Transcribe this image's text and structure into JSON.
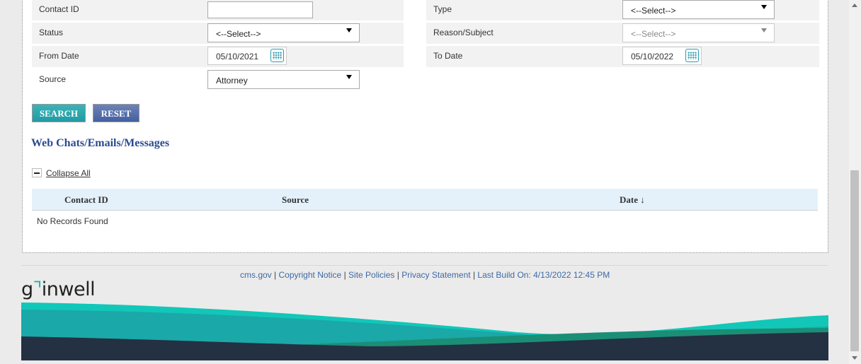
{
  "form": {
    "contact_id_label": "Contact ID",
    "contact_id_value": "",
    "type_label": "Type",
    "type_value": "<--Select-->",
    "status_label": "Status",
    "status_value": "<--Select-->",
    "reason_label": "Reason/Subject",
    "reason_value": "<--Select-->",
    "from_date_label": "From Date",
    "from_date_value": "05/10/2021",
    "to_date_label": "To Date",
    "to_date_value": "05/10/2022",
    "source_label": "Source",
    "source_value": "Attorney"
  },
  "buttons": {
    "search": "SEARCH",
    "reset": "RESET"
  },
  "section": {
    "title": "Web Chats/Emails/Messages",
    "collapse_all": "Collapse All"
  },
  "table": {
    "headers": {
      "contact_id": "Contact ID",
      "source": "Source",
      "date": "Date ↓"
    },
    "empty_message": "No Records Found"
  },
  "footer": {
    "links": [
      "cms.gov",
      "Copyright Notice",
      "Site Policies",
      "Privacy Statement"
    ],
    "build": "Last Build On: 4/13/2022 12:45 PM",
    "separator": "|",
    "logo_text_pre": "g",
    "logo_accent": "⌝",
    "logo_text_post": "inwell"
  },
  "colors": {
    "teal_accent": "#17b6a4",
    "title_blue": "#2b4a8f",
    "link_blue": "#3c6aa5",
    "search_button": "#2aa6ad",
    "reset_button": "#506aa8",
    "table_header_bg": "#e4f1fa"
  },
  "icons": {
    "calendar": "calendar-icon",
    "dropdown": "chevron-down-icon",
    "collapse": "minus-icon",
    "sort": "arrow-down-icon"
  }
}
